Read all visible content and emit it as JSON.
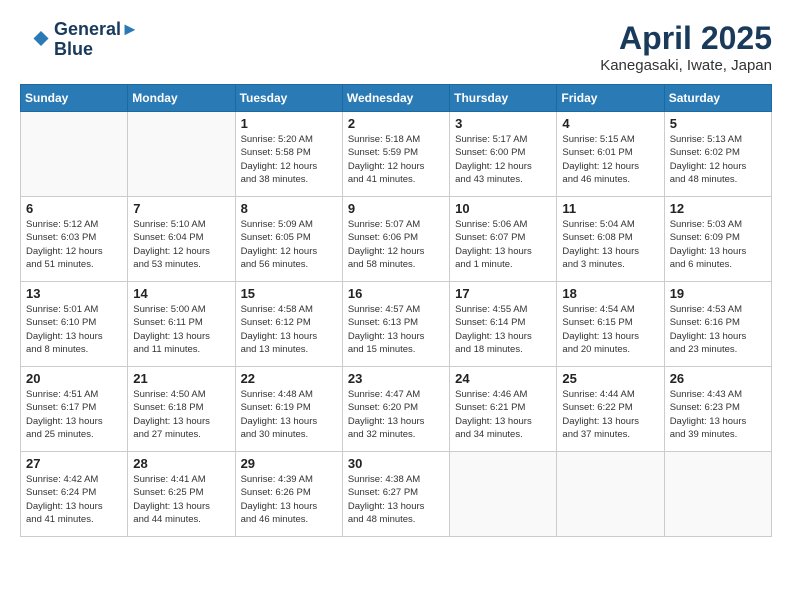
{
  "header": {
    "logo_line1": "General",
    "logo_line2": "Blue",
    "month_title": "April 2025",
    "subtitle": "Kanegasaki, Iwate, Japan"
  },
  "weekdays": [
    "Sunday",
    "Monday",
    "Tuesday",
    "Wednesday",
    "Thursday",
    "Friday",
    "Saturday"
  ],
  "weeks": [
    [
      {
        "day": "",
        "info": ""
      },
      {
        "day": "",
        "info": ""
      },
      {
        "day": "1",
        "info": "Sunrise: 5:20 AM\nSunset: 5:58 PM\nDaylight: 12 hours\nand 38 minutes."
      },
      {
        "day": "2",
        "info": "Sunrise: 5:18 AM\nSunset: 5:59 PM\nDaylight: 12 hours\nand 41 minutes."
      },
      {
        "day": "3",
        "info": "Sunrise: 5:17 AM\nSunset: 6:00 PM\nDaylight: 12 hours\nand 43 minutes."
      },
      {
        "day": "4",
        "info": "Sunrise: 5:15 AM\nSunset: 6:01 PM\nDaylight: 12 hours\nand 46 minutes."
      },
      {
        "day": "5",
        "info": "Sunrise: 5:13 AM\nSunset: 6:02 PM\nDaylight: 12 hours\nand 48 minutes."
      }
    ],
    [
      {
        "day": "6",
        "info": "Sunrise: 5:12 AM\nSunset: 6:03 PM\nDaylight: 12 hours\nand 51 minutes."
      },
      {
        "day": "7",
        "info": "Sunrise: 5:10 AM\nSunset: 6:04 PM\nDaylight: 12 hours\nand 53 minutes."
      },
      {
        "day": "8",
        "info": "Sunrise: 5:09 AM\nSunset: 6:05 PM\nDaylight: 12 hours\nand 56 minutes."
      },
      {
        "day": "9",
        "info": "Sunrise: 5:07 AM\nSunset: 6:06 PM\nDaylight: 12 hours\nand 58 minutes."
      },
      {
        "day": "10",
        "info": "Sunrise: 5:06 AM\nSunset: 6:07 PM\nDaylight: 13 hours\nand 1 minute."
      },
      {
        "day": "11",
        "info": "Sunrise: 5:04 AM\nSunset: 6:08 PM\nDaylight: 13 hours\nand 3 minutes."
      },
      {
        "day": "12",
        "info": "Sunrise: 5:03 AM\nSunset: 6:09 PM\nDaylight: 13 hours\nand 6 minutes."
      }
    ],
    [
      {
        "day": "13",
        "info": "Sunrise: 5:01 AM\nSunset: 6:10 PM\nDaylight: 13 hours\nand 8 minutes."
      },
      {
        "day": "14",
        "info": "Sunrise: 5:00 AM\nSunset: 6:11 PM\nDaylight: 13 hours\nand 11 minutes."
      },
      {
        "day": "15",
        "info": "Sunrise: 4:58 AM\nSunset: 6:12 PM\nDaylight: 13 hours\nand 13 minutes."
      },
      {
        "day": "16",
        "info": "Sunrise: 4:57 AM\nSunset: 6:13 PM\nDaylight: 13 hours\nand 15 minutes."
      },
      {
        "day": "17",
        "info": "Sunrise: 4:55 AM\nSunset: 6:14 PM\nDaylight: 13 hours\nand 18 minutes."
      },
      {
        "day": "18",
        "info": "Sunrise: 4:54 AM\nSunset: 6:15 PM\nDaylight: 13 hours\nand 20 minutes."
      },
      {
        "day": "19",
        "info": "Sunrise: 4:53 AM\nSunset: 6:16 PM\nDaylight: 13 hours\nand 23 minutes."
      }
    ],
    [
      {
        "day": "20",
        "info": "Sunrise: 4:51 AM\nSunset: 6:17 PM\nDaylight: 13 hours\nand 25 minutes."
      },
      {
        "day": "21",
        "info": "Sunrise: 4:50 AM\nSunset: 6:18 PM\nDaylight: 13 hours\nand 27 minutes."
      },
      {
        "day": "22",
        "info": "Sunrise: 4:48 AM\nSunset: 6:19 PM\nDaylight: 13 hours\nand 30 minutes."
      },
      {
        "day": "23",
        "info": "Sunrise: 4:47 AM\nSunset: 6:20 PM\nDaylight: 13 hours\nand 32 minutes."
      },
      {
        "day": "24",
        "info": "Sunrise: 4:46 AM\nSunset: 6:21 PM\nDaylight: 13 hours\nand 34 minutes."
      },
      {
        "day": "25",
        "info": "Sunrise: 4:44 AM\nSunset: 6:22 PM\nDaylight: 13 hours\nand 37 minutes."
      },
      {
        "day": "26",
        "info": "Sunrise: 4:43 AM\nSunset: 6:23 PM\nDaylight: 13 hours\nand 39 minutes."
      }
    ],
    [
      {
        "day": "27",
        "info": "Sunrise: 4:42 AM\nSunset: 6:24 PM\nDaylight: 13 hours\nand 41 minutes."
      },
      {
        "day": "28",
        "info": "Sunrise: 4:41 AM\nSunset: 6:25 PM\nDaylight: 13 hours\nand 44 minutes."
      },
      {
        "day": "29",
        "info": "Sunrise: 4:39 AM\nSunset: 6:26 PM\nDaylight: 13 hours\nand 46 minutes."
      },
      {
        "day": "30",
        "info": "Sunrise: 4:38 AM\nSunset: 6:27 PM\nDaylight: 13 hours\nand 48 minutes."
      },
      {
        "day": "",
        "info": ""
      },
      {
        "day": "",
        "info": ""
      },
      {
        "day": "",
        "info": ""
      }
    ]
  ]
}
